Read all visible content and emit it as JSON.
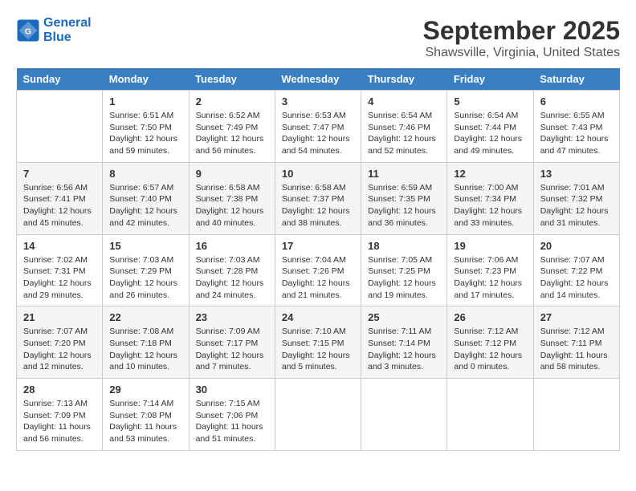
{
  "header": {
    "logo_line1": "General",
    "logo_line2": "Blue",
    "month_title": "September 2025",
    "location": "Shawsville, Virginia, United States"
  },
  "days_of_week": [
    "Sunday",
    "Monday",
    "Tuesday",
    "Wednesday",
    "Thursday",
    "Friday",
    "Saturday"
  ],
  "weeks": [
    [
      {
        "day": "",
        "info": ""
      },
      {
        "day": "1",
        "info": "Sunrise: 6:51 AM\nSunset: 7:50 PM\nDaylight: 12 hours\nand 59 minutes."
      },
      {
        "day": "2",
        "info": "Sunrise: 6:52 AM\nSunset: 7:49 PM\nDaylight: 12 hours\nand 56 minutes."
      },
      {
        "day": "3",
        "info": "Sunrise: 6:53 AM\nSunset: 7:47 PM\nDaylight: 12 hours\nand 54 minutes."
      },
      {
        "day": "4",
        "info": "Sunrise: 6:54 AM\nSunset: 7:46 PM\nDaylight: 12 hours\nand 52 minutes."
      },
      {
        "day": "5",
        "info": "Sunrise: 6:54 AM\nSunset: 7:44 PM\nDaylight: 12 hours\nand 49 minutes."
      },
      {
        "day": "6",
        "info": "Sunrise: 6:55 AM\nSunset: 7:43 PM\nDaylight: 12 hours\nand 47 minutes."
      }
    ],
    [
      {
        "day": "7",
        "info": "Sunrise: 6:56 AM\nSunset: 7:41 PM\nDaylight: 12 hours\nand 45 minutes."
      },
      {
        "day": "8",
        "info": "Sunrise: 6:57 AM\nSunset: 7:40 PM\nDaylight: 12 hours\nand 42 minutes."
      },
      {
        "day": "9",
        "info": "Sunrise: 6:58 AM\nSunset: 7:38 PM\nDaylight: 12 hours\nand 40 minutes."
      },
      {
        "day": "10",
        "info": "Sunrise: 6:58 AM\nSunset: 7:37 PM\nDaylight: 12 hours\nand 38 minutes."
      },
      {
        "day": "11",
        "info": "Sunrise: 6:59 AM\nSunset: 7:35 PM\nDaylight: 12 hours\nand 36 minutes."
      },
      {
        "day": "12",
        "info": "Sunrise: 7:00 AM\nSunset: 7:34 PM\nDaylight: 12 hours\nand 33 minutes."
      },
      {
        "day": "13",
        "info": "Sunrise: 7:01 AM\nSunset: 7:32 PM\nDaylight: 12 hours\nand 31 minutes."
      }
    ],
    [
      {
        "day": "14",
        "info": "Sunrise: 7:02 AM\nSunset: 7:31 PM\nDaylight: 12 hours\nand 29 minutes."
      },
      {
        "day": "15",
        "info": "Sunrise: 7:03 AM\nSunset: 7:29 PM\nDaylight: 12 hours\nand 26 minutes."
      },
      {
        "day": "16",
        "info": "Sunrise: 7:03 AM\nSunset: 7:28 PM\nDaylight: 12 hours\nand 24 minutes."
      },
      {
        "day": "17",
        "info": "Sunrise: 7:04 AM\nSunset: 7:26 PM\nDaylight: 12 hours\nand 21 minutes."
      },
      {
        "day": "18",
        "info": "Sunrise: 7:05 AM\nSunset: 7:25 PM\nDaylight: 12 hours\nand 19 minutes."
      },
      {
        "day": "19",
        "info": "Sunrise: 7:06 AM\nSunset: 7:23 PM\nDaylight: 12 hours\nand 17 minutes."
      },
      {
        "day": "20",
        "info": "Sunrise: 7:07 AM\nSunset: 7:22 PM\nDaylight: 12 hours\nand 14 minutes."
      }
    ],
    [
      {
        "day": "21",
        "info": "Sunrise: 7:07 AM\nSunset: 7:20 PM\nDaylight: 12 hours\nand 12 minutes."
      },
      {
        "day": "22",
        "info": "Sunrise: 7:08 AM\nSunset: 7:18 PM\nDaylight: 12 hours\nand 10 minutes."
      },
      {
        "day": "23",
        "info": "Sunrise: 7:09 AM\nSunset: 7:17 PM\nDaylight: 12 hours\nand 7 minutes."
      },
      {
        "day": "24",
        "info": "Sunrise: 7:10 AM\nSunset: 7:15 PM\nDaylight: 12 hours\nand 5 minutes."
      },
      {
        "day": "25",
        "info": "Sunrise: 7:11 AM\nSunset: 7:14 PM\nDaylight: 12 hours\nand 3 minutes."
      },
      {
        "day": "26",
        "info": "Sunrise: 7:12 AM\nSunset: 7:12 PM\nDaylight: 12 hours\nand 0 minutes."
      },
      {
        "day": "27",
        "info": "Sunrise: 7:12 AM\nSunset: 7:11 PM\nDaylight: 11 hours\nand 58 minutes."
      }
    ],
    [
      {
        "day": "28",
        "info": "Sunrise: 7:13 AM\nSunset: 7:09 PM\nDaylight: 11 hours\nand 56 minutes."
      },
      {
        "day": "29",
        "info": "Sunrise: 7:14 AM\nSunset: 7:08 PM\nDaylight: 11 hours\nand 53 minutes."
      },
      {
        "day": "30",
        "info": "Sunrise: 7:15 AM\nSunset: 7:06 PM\nDaylight: 11 hours\nand 51 minutes."
      },
      {
        "day": "",
        "info": ""
      },
      {
        "day": "",
        "info": ""
      },
      {
        "day": "",
        "info": ""
      },
      {
        "day": "",
        "info": ""
      }
    ]
  ]
}
